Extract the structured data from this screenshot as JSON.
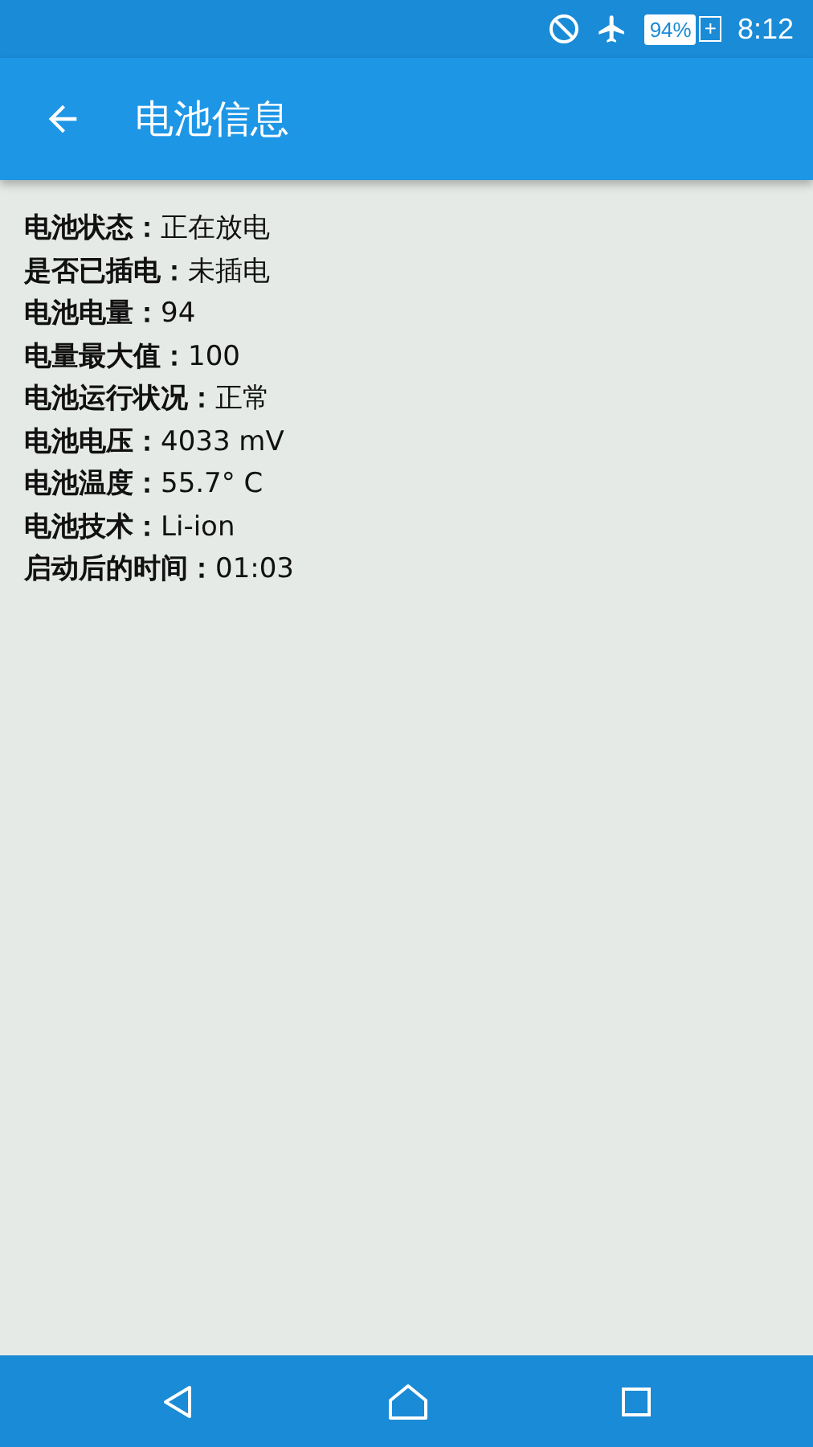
{
  "status_bar": {
    "battery_percent": "94%",
    "battery_plus": "+",
    "time": "8:12"
  },
  "app_bar": {
    "title": "电池信息"
  },
  "info": [
    {
      "label": "电池状态：",
      "value": "正在放电"
    },
    {
      "label": "是否已插电：",
      "value": "未插电"
    },
    {
      "label": "电池电量：",
      "value": "94"
    },
    {
      "label": "电量最大值：",
      "value": "100"
    },
    {
      "label": "电池运行状况：",
      "value": "正常"
    },
    {
      "label": "电池电压：",
      "value": "4033 mV"
    },
    {
      "label": "电池温度：",
      "value": "55.7° C"
    },
    {
      "label": "电池技术：",
      "value": "Li-ion"
    },
    {
      "label": "启动后的时间：",
      "value": "01:03"
    }
  ]
}
